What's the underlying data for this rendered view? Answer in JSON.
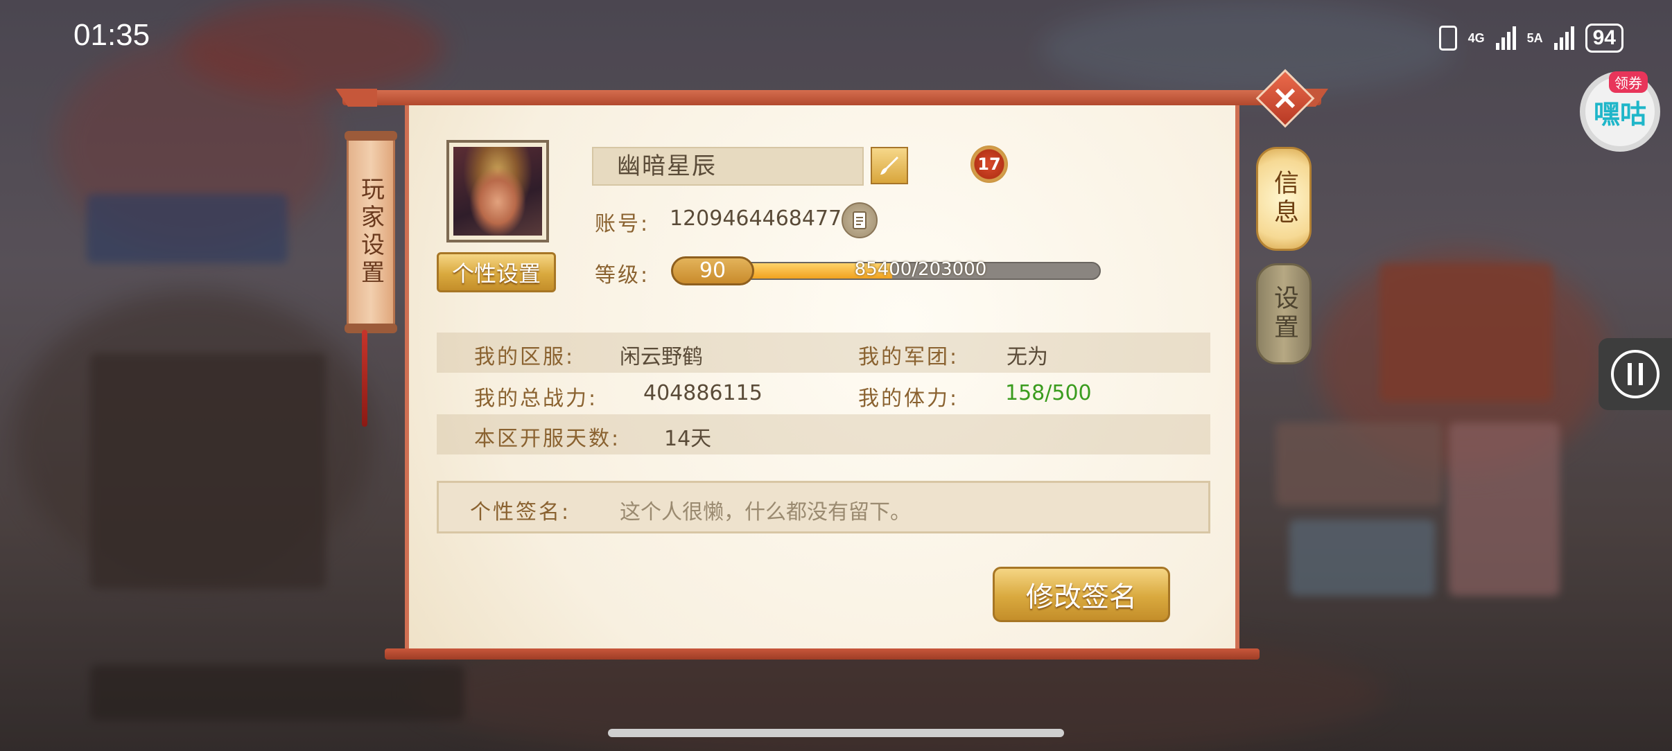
{
  "status_bar": {
    "time": "01:35",
    "network1": "4G",
    "network2": "5A",
    "battery": "94"
  },
  "widgets": {
    "hegu_tag": "领券",
    "hegu_label": "嘿咕"
  },
  "dialog": {
    "side_tab": "玩家设置",
    "tab_info": "信息",
    "tab_settings": "设置",
    "close_icon": "close-icon",
    "player_name": "幽暗星辰",
    "vip_level": "17",
    "account_label": "账号:",
    "account_id": "12094644684778",
    "level_label": "等级:",
    "level": "90",
    "exp_text": "85400/203000",
    "exp_progress": 0.42,
    "personal_button": "个性设置",
    "stats": {
      "server_label": "我的区服:",
      "server_value": "闲云野鹤",
      "legion_label": "我的军团:",
      "legion_value": "无为",
      "power_label": "我的总战力:",
      "power_value": "404886115",
      "stamina_label": "我的体力:",
      "stamina_value": "158/500",
      "days_label": "本区开服天数:",
      "days_value": "14天"
    },
    "signature_label": "个性签名:",
    "signature_text": "这个人很懒，什么都没有留下。",
    "edit_signature_button": "修改签名"
  },
  "colors": {
    "accent_gold": "#d9a93e",
    "label_brown": "#8a6230",
    "stamina_green": "#3a9c1e",
    "frame_red": "#cf6f52"
  }
}
